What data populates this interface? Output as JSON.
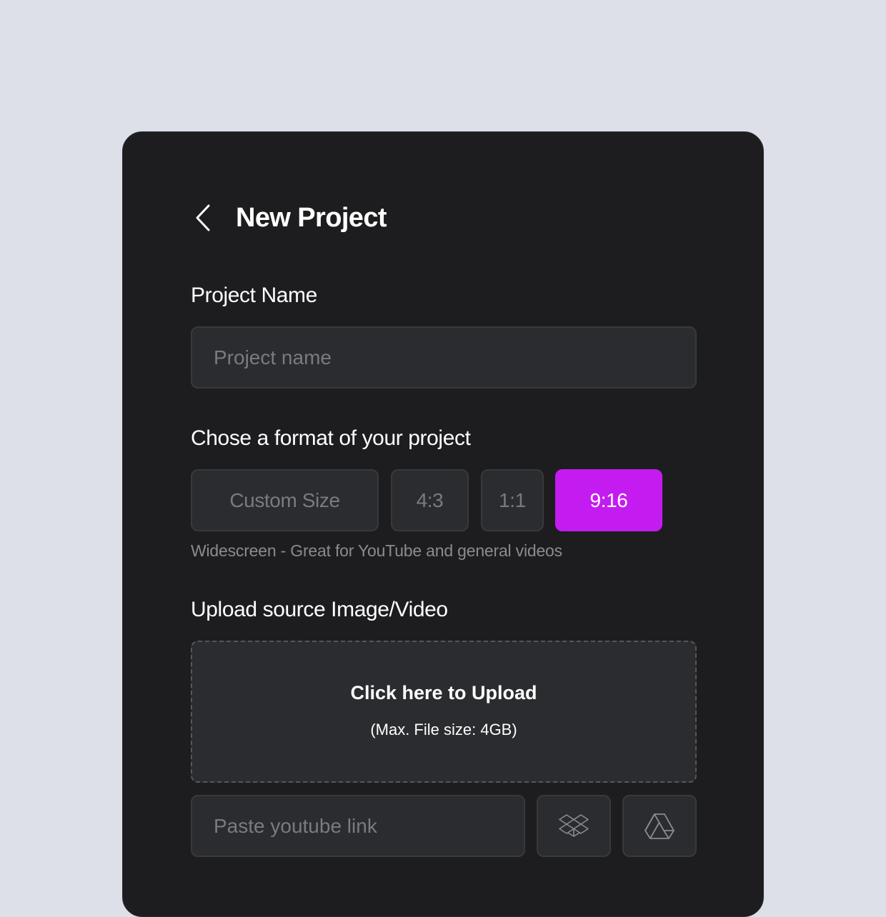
{
  "header": {
    "title": "New Project",
    "back_icon": "chevron-left-icon"
  },
  "project_name": {
    "label": "Project Name",
    "placeholder": "Project name",
    "value": ""
  },
  "format": {
    "label": "Chose a format of your project",
    "options": [
      {
        "label": "Custom Size",
        "selected": false
      },
      {
        "label": "4:3",
        "selected": false
      },
      {
        "label": "1:1",
        "selected": false
      },
      {
        "label": "9:16",
        "selected": true
      }
    ],
    "hint": "Widescreen - Great for YouTube and general videos"
  },
  "upload": {
    "label": "Upload source Image/Video",
    "title": "Click here to Upload",
    "subtitle": "(Max. File size: 4GB)",
    "youtube_placeholder": "Paste youtube link",
    "youtube_value": "",
    "dropbox_icon": "dropbox-icon",
    "drive_icon": "google-drive-icon"
  },
  "colors": {
    "background": "#dde0e8",
    "panel": "#1d1d1f",
    "field": "#2b2c2f",
    "accent": "#c41cf0"
  }
}
